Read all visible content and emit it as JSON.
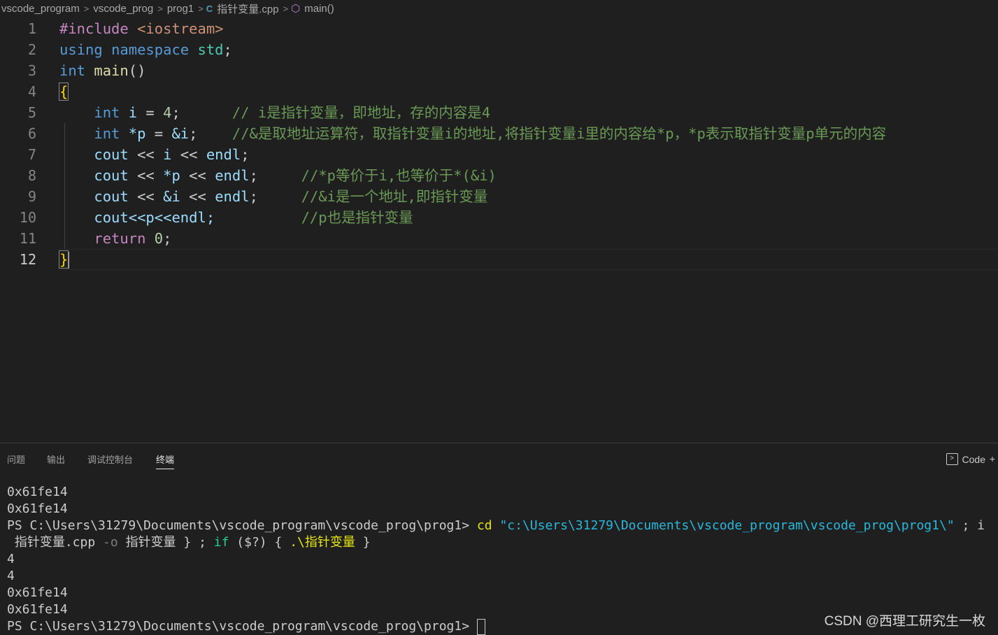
{
  "breadcrumb": {
    "items": [
      "vscode_program",
      "vscode_prog",
      "prog1"
    ],
    "file_icon": "C",
    "file": "指针变量.cpp",
    "symbol": "main()"
  },
  "editor": {
    "line_numbers": [
      "1",
      "2",
      "3",
      "4",
      "5",
      "6",
      "7",
      "8",
      "9",
      "10",
      "11",
      "12"
    ],
    "active_line": "12",
    "tokens": {
      "include": "#include",
      "iostream": "<iostream>",
      "using": "using",
      "namespace": "namespace",
      "std": "std",
      "semi": ";",
      "int": "int",
      "main": "main",
      "parens": "()",
      "lbrace": "{",
      "rbrace": "}",
      "i": "i",
      "eq": " = ",
      "four": "4",
      "star_p": "*p",
      "amp_i": "&i",
      "cout": "cout",
      "shl": " << ",
      "endl": "endl",
      "line10": "cout<<p<<endl;",
      "return": "return",
      "zero": "0"
    },
    "comments": {
      "line5": "// i是指针变量，即地址，存的内容是4",
      "line6": "//&是取地址运算符，取指针变量i的地址,将指针变量i里的内容给*p，*p表示取指针变量p单元的内容",
      "line8": "//*p等价于i,也等价于*(&i)",
      "line9": "//&i是一个地址,即指针变量",
      "line10": "//p也是指针变量"
    }
  },
  "panel": {
    "tabs": [
      "问题",
      "输出",
      "调试控制台",
      "终端"
    ],
    "active_tab": "终端",
    "launcher_label": "Code",
    "launcher_icon": "terminal-icon"
  },
  "terminal": {
    "out1": "0x61fe14",
    "out2": "0x61fe14",
    "prompt": "PS C:\\Users\\31279\\Documents\\vscode_program\\vscode_prog\\prog1>",
    "cmd_cd": "cd",
    "cmd_path": "\"c:\\Users\\31279\\Documents\\vscode_program\\vscode_prog\\prog1\\\"",
    "cmd_rest": " ; i",
    "wrap_src": " 指针变量.cpp",
    "wrap_flag": "-o",
    "wrap_out": "指针变量",
    "wrap_sep": "} ; ",
    "wrap_if": "if",
    "wrap_cond": "($?)",
    "wrap_open": "{",
    "wrap_run": ".\\指针变量",
    "wrap_close": "}",
    "out3": "4",
    "out4": "4",
    "out5": "0x61fe14",
    "out6": "0x61fe14",
    "prompt2": "PS C:\\Users\\31279\\Documents\\vscode_program\\vscode_prog\\prog1>"
  },
  "watermark": "CSDN @西理工研究生一枚",
  "colors": {
    "background": "#1f1f1f",
    "keyword": "#569cd6",
    "comment": "#6a9955",
    "string": "#ce9178",
    "terminal_command": "#e5e510",
    "terminal_string": "#29b8db"
  }
}
